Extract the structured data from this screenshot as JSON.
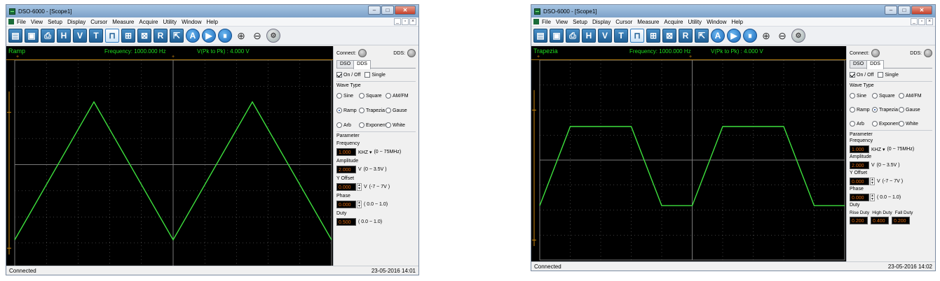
{
  "windows": [
    {
      "title": "DSO-6000 - [Scope1]",
      "menus": [
        "File",
        "View",
        "Setup",
        "Display",
        "Cursor",
        "Measure",
        "Acquire",
        "Utility",
        "Window",
        "Help"
      ],
      "scope": {
        "wave_name": "Ramp",
        "frequency": "Frequency: 1000.000 Hz",
        "vpp": "V(Pk to Pk) : 4.000 V"
      },
      "wave_type_selected": "Ramp",
      "waveform_points": [
        [
          0,
          1.0
        ],
        [
          0.25,
          0.0
        ],
        [
          0.5,
          1.0
        ],
        [
          0.75,
          0.0
        ],
        [
          1.0,
          1.0
        ]
      ],
      "panel": {
        "connect": "Connect:",
        "dds": "DDS:",
        "tabs": [
          "DSO",
          "DDS"
        ],
        "on_off": "On / Off",
        "single": "Single",
        "wave_type": "Wave Type",
        "types": [
          "Sine",
          "Square",
          "AM/FM",
          "Ramp",
          "Trapezia",
          "Gause",
          "Arb",
          "Exponent",
          "White"
        ],
        "parameter": "Parameter",
        "frequency_label": "Frequency",
        "frequency_value": "1.000",
        "frequency_unit": "KHZ",
        "frequency_range": "(0 ~ 75MHz)",
        "amplitude_label": "Amplitude",
        "amplitude_value": "2.000",
        "amplitude_unit": "V",
        "amplitude_range": "(0 ~ 3.5V )",
        "offset_label": "Y Offset",
        "offset_value": "0.000",
        "offset_unit": "V",
        "offset_range": "(-7 ~ 7V )",
        "phase_label": "Phase",
        "phase_value": "0.000",
        "phase_range": "( 0.0 ~ 1.0)",
        "duty_label": "Duty",
        "duty_value": "0.500",
        "duty_range": "( 0.0 ~ 1.0)"
      },
      "status": {
        "left": "Connected",
        "right": "23-05-2016  14:01"
      }
    },
    {
      "title": "DSO-6000 - [Scope1]",
      "menus": [
        "File",
        "View",
        "Setup",
        "Display",
        "Cursor",
        "Measure",
        "Acquire",
        "Utility",
        "Window",
        "Help"
      ],
      "scope": {
        "wave_name": "Trapezia",
        "frequency": "Frequency: 1000.000 Hz",
        "vpp": "V(Pk to Pk) : 4.000 V"
      },
      "wave_type_selected": "Trapezia",
      "waveform_points": [
        [
          0,
          0.8
        ],
        [
          0.1,
          0.2
        ],
        [
          0.3,
          0.2
        ],
        [
          0.4,
          0.8
        ],
        [
          0.5,
          0.8
        ],
        [
          0.6,
          0.2
        ],
        [
          0.8,
          0.2
        ],
        [
          0.9,
          0.8
        ],
        [
          1.0,
          0.8
        ]
      ],
      "panel": {
        "connect": "Connect:",
        "dds": "DDS:",
        "tabs": [
          "DSO",
          "DDS"
        ],
        "on_off": "On / Off",
        "single": "Single",
        "wave_type": "Wave Type",
        "types": [
          "Sine",
          "Square",
          "AM/FM",
          "Ramp",
          "Trapezia",
          "Gause",
          "Arb",
          "Exponent",
          "White"
        ],
        "parameter": "Parameter",
        "frequency_label": "Frequency",
        "frequency_value": "1.000",
        "frequency_unit": "KHZ",
        "frequency_range": "(0 ~ 75MHz)",
        "amplitude_label": "Amplitude",
        "amplitude_value": "2.000",
        "amplitude_unit": "V",
        "amplitude_range": "(0 ~ 3.5V )",
        "offset_label": "Y Offset",
        "offset_value": "0.000",
        "offset_unit": "V",
        "offset_range": "(-7 ~ 7V )",
        "phase_label": "Phase",
        "phase_value": "0.000",
        "phase_range": "( 0.0 ~ 1.0)",
        "duty_label": "Duty",
        "rise_duty": "Rise Duty",
        "high_duty": "High Duty",
        "fall_duty": "Fall Duty",
        "rise_value": "0.200",
        "high_value": "0.400",
        "fall_value": "0.200"
      },
      "status": {
        "left": "Connected",
        "right": "23-05-2016  14:02"
      }
    }
  ],
  "colors": {
    "trace": "#3de03d",
    "grid": "#7a7a7a",
    "screen": "#000000",
    "value_text": "#e06a10"
  }
}
